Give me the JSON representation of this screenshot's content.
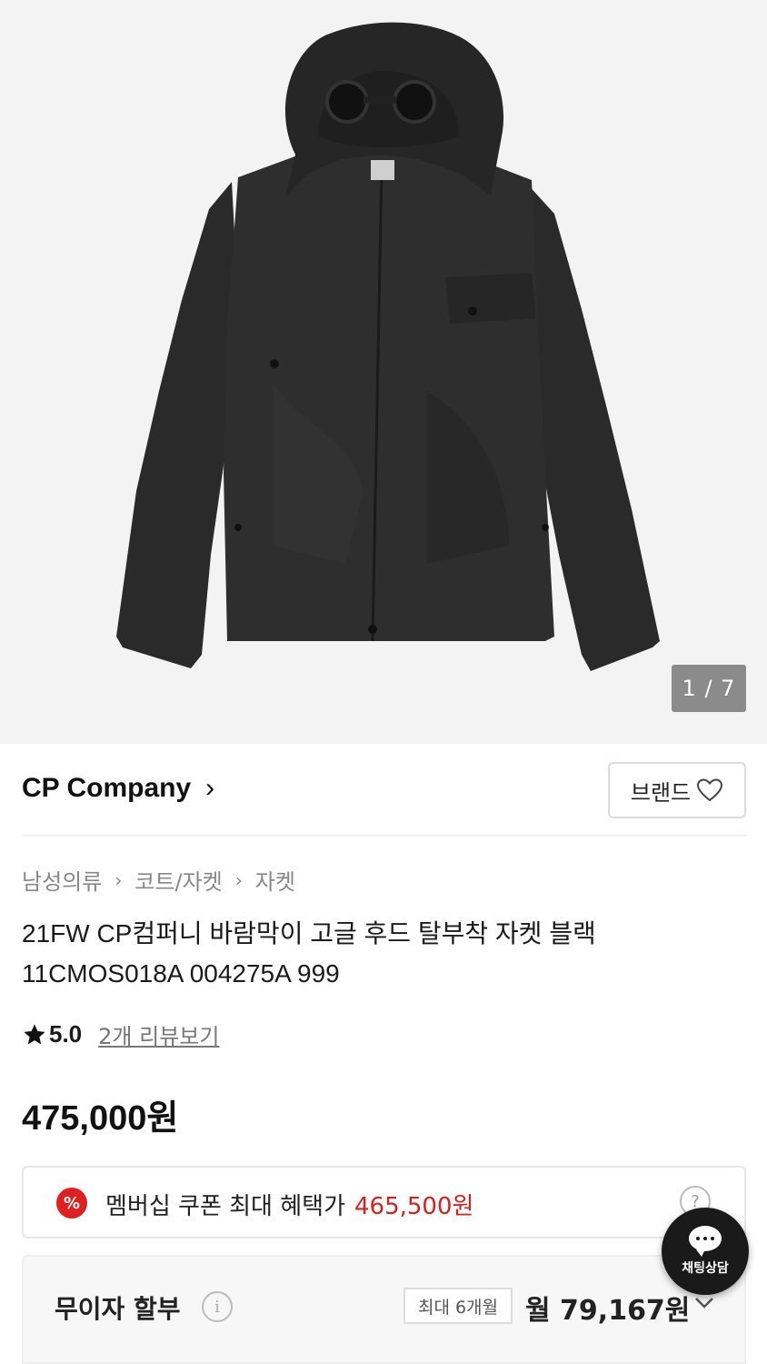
{
  "gallery": {
    "page_counter": "1 / 7",
    "image_alt": "black hooded jacket with goggle hood"
  },
  "brand": {
    "name": "CP Company",
    "chevron": "›",
    "brand_button_label": "브랜드",
    "brand_button_icon": "heart-outline-icon"
  },
  "breadcrumb": {
    "items": [
      "남성의류",
      "코트/자켓",
      "자켓"
    ],
    "separator": "›"
  },
  "product": {
    "title_line1": "21FW CP컴퍼니 바람막이 고글 후드 탈부착 자켓 블랙",
    "title_line2": "11CMOS018A 004275A 999",
    "rating": "5.0",
    "review_link": "2개 리뷰보기",
    "price": "475,000원"
  },
  "coupon": {
    "icon": "%",
    "label": "멤버십 쿠폰 최대 혜택가",
    "benefit_price": "465,500원",
    "help_icon": "?"
  },
  "installment": {
    "label": "무이자 할부",
    "info_icon": "i",
    "months_badge": "최대 6개월",
    "monthly_amount": "월 79,167원"
  },
  "chat": {
    "label": "채팅상담"
  },
  "colors": {
    "accent_red": "#d92020",
    "chat_bg": "#1a1a1a",
    "hero_bg": "#f3f3f3"
  }
}
